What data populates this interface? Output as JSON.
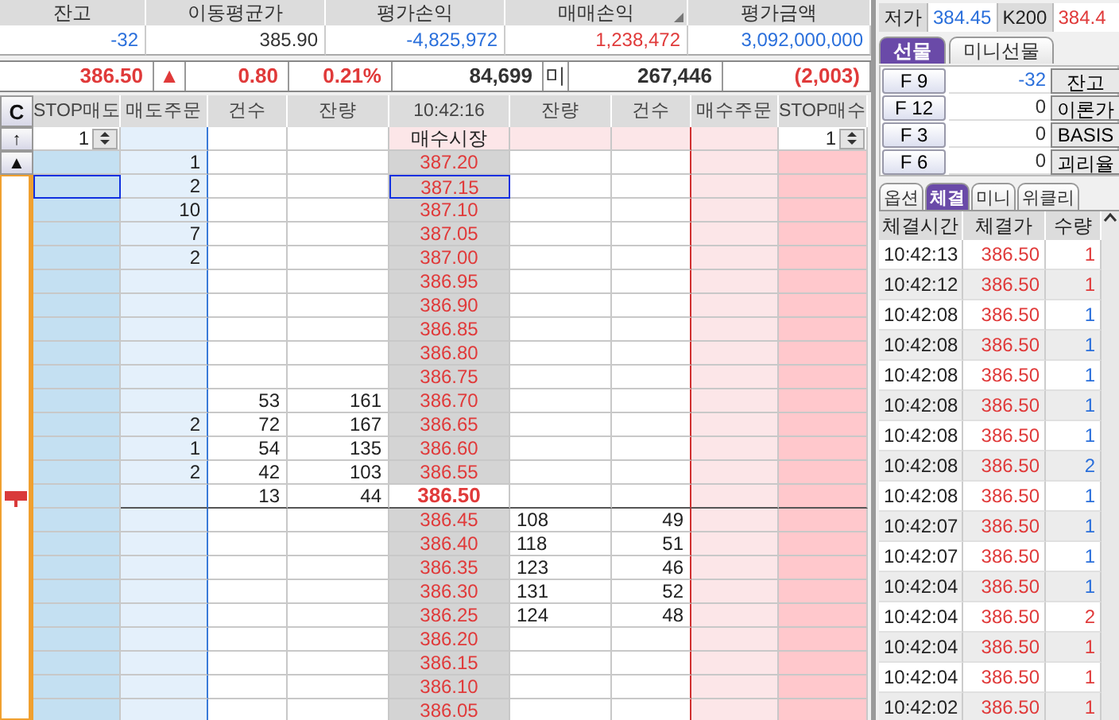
{
  "summary": {
    "columns": [
      {
        "label": "잔고",
        "value": "-32",
        "color": "#2a6fdb"
      },
      {
        "label": "이동평균가",
        "value": "385.90",
        "color": "#333333"
      },
      {
        "label": "평가손익",
        "value": "-4,825,972",
        "color": "#2a6fdb"
      },
      {
        "label": "매매손익",
        "value": "1,238,472",
        "color": "#e03a3a"
      },
      {
        "label": "평가금액",
        "value": "3,092,000,000",
        "color": "#2a6fdb"
      }
    ]
  },
  "quote_bar": [
    {
      "text": "386.50",
      "color": "#e03a3a"
    },
    {
      "text": "▲",
      "color": "#e03a3a"
    },
    {
      "text": "0.80",
      "color": "#e03a3a"
    },
    {
      "text": "0.21%",
      "color": "#e03a3a"
    },
    {
      "text": "84,699",
      "color": "#333333"
    },
    {
      "text": "미",
      "color": "#333333"
    },
    {
      "text": "267,446",
      "color": "#333333"
    },
    {
      "text": "(2,003)",
      "color": "#e03a3a"
    }
  ],
  "order_book": {
    "side_buttons": [
      "C",
      "↑",
      "▲"
    ],
    "columns": [
      "STOP매도",
      "매도주문",
      "건수",
      "잔량",
      "10:42:16",
      "잔량",
      "건수",
      "매수주문",
      "STOP매수"
    ],
    "stop_sell_qty": "1",
    "stop_buy_qty": "1",
    "market_buy_label": "매수시장",
    "rows": [
      {
        "price": "387.20",
        "sell_order": "1",
        "selected": false,
        "current": false
      },
      {
        "price": "387.15",
        "sell_order": "2",
        "selected": true,
        "current": false
      },
      {
        "price": "387.10",
        "sell_order": "10",
        "selected": false,
        "current": false
      },
      {
        "price": "387.05",
        "sell_order": "7",
        "selected": false,
        "current": false
      },
      {
        "price": "387.00",
        "sell_order": "2",
        "selected": false,
        "current": false
      },
      {
        "price": "386.95",
        "selected": false,
        "current": false
      },
      {
        "price": "386.90",
        "selected": false,
        "current": false
      },
      {
        "price": "386.85",
        "selected": false,
        "current": false
      },
      {
        "price": "386.80",
        "selected": false,
        "current": false
      },
      {
        "price": "386.75",
        "selected": false,
        "current": false
      },
      {
        "price": "386.70",
        "sell_count": "53",
        "sell_qty": "161",
        "selected": false,
        "current": false
      },
      {
        "price": "386.65",
        "sell_order": "2",
        "sell_count": "72",
        "sell_qty": "167",
        "selected": false,
        "current": false
      },
      {
        "price": "386.60",
        "sell_order": "1",
        "sell_count": "54",
        "sell_qty": "135",
        "selected": false,
        "current": false
      },
      {
        "price": "386.55",
        "sell_order": "2",
        "sell_count": "42",
        "sell_qty": "103",
        "selected": false,
        "current": false
      },
      {
        "price": "386.50",
        "sell_count": "13",
        "sell_qty": "44",
        "selected": false,
        "current": true
      },
      {
        "price": "386.45",
        "buy_qty": "108",
        "buy_count": "49",
        "selected": false,
        "current": false
      },
      {
        "price": "386.40",
        "buy_qty": "118",
        "buy_count": "51",
        "selected": false,
        "current": false
      },
      {
        "price": "386.35",
        "buy_qty": "123",
        "buy_count": "46",
        "selected": false,
        "current": false
      },
      {
        "price": "386.30",
        "buy_qty": "131",
        "buy_count": "52",
        "selected": false,
        "current": false
      },
      {
        "price": "386.25",
        "buy_qty": "124",
        "buy_count": "48",
        "selected": false,
        "current": false
      },
      {
        "price": "386.20",
        "selected": false,
        "current": false
      },
      {
        "price": "386.15",
        "selected": false,
        "current": false
      },
      {
        "price": "386.10",
        "selected": false,
        "current": false
      },
      {
        "price": "386.05",
        "selected": false,
        "current": false
      }
    ]
  },
  "side_panel": {
    "quotes": [
      {
        "label": "저가",
        "value": "384.45",
        "color": "#2a6fdb"
      },
      {
        "label": "K200",
        "value": "384.4",
        "color": "#e03a3a"
      }
    ],
    "futures_tabs": [
      {
        "label": "선물",
        "selected": true
      },
      {
        "label": "미니선물",
        "selected": false
      }
    ],
    "futures_rows": [
      {
        "code": "F 9",
        "value": "-32",
        "color": "#2a6fdb",
        "button": "잔고"
      },
      {
        "code": "F 12",
        "value": "0",
        "color": "#333333",
        "button": "이론가"
      },
      {
        "code": "F 3",
        "value": "0",
        "color": "#333333",
        "button": "BASIS"
      },
      {
        "code": "F 6",
        "value": "0",
        "color": "#333333",
        "button": "괴리율"
      }
    ],
    "trade_tabs": [
      {
        "label": "옵션",
        "selected": false
      },
      {
        "label": "체결",
        "selected": true
      },
      {
        "label": "미니",
        "selected": false
      },
      {
        "label": "위클리",
        "selected": false
      }
    ],
    "trade_columns": [
      "체결시간",
      "체결가",
      "수량"
    ],
    "trades": [
      {
        "time": "10:42:13",
        "price": "386.50",
        "qty": "1",
        "color": "#e03a3a"
      },
      {
        "time": "10:42:12",
        "price": "386.50",
        "qty": "1",
        "color": "#e03a3a"
      },
      {
        "time": "10:42:08",
        "price": "386.50",
        "qty": "1",
        "color": "#2a6fdb"
      },
      {
        "time": "10:42:08",
        "price": "386.50",
        "qty": "1",
        "color": "#2a6fdb"
      },
      {
        "time": "10:42:08",
        "price": "386.50",
        "qty": "1",
        "color": "#2a6fdb"
      },
      {
        "time": "10:42:08",
        "price": "386.50",
        "qty": "1",
        "color": "#2a6fdb"
      },
      {
        "time": "10:42:08",
        "price": "386.50",
        "qty": "1",
        "color": "#2a6fdb"
      },
      {
        "time": "10:42:08",
        "price": "386.50",
        "qty": "2",
        "color": "#2a6fdb"
      },
      {
        "time": "10:42:08",
        "price": "386.50",
        "qty": "1",
        "color": "#2a6fdb"
      },
      {
        "time": "10:42:07",
        "price": "386.50",
        "qty": "1",
        "color": "#2a6fdb"
      },
      {
        "time": "10:42:07",
        "price": "386.50",
        "qty": "1",
        "color": "#2a6fdb"
      },
      {
        "time": "10:42:04",
        "price": "386.50",
        "qty": "1",
        "color": "#2a6fdb"
      },
      {
        "time": "10:42:04",
        "price": "386.50",
        "qty": "2",
        "color": "#e03a3a"
      },
      {
        "time": "10:42:04",
        "price": "386.50",
        "qty": "1",
        "color": "#e03a3a"
      },
      {
        "time": "10:42:04",
        "price": "386.50",
        "qty": "1",
        "color": "#e03a3a"
      },
      {
        "time": "10:42:02",
        "price": "386.50",
        "qty": "1",
        "color": "#e03a3a"
      }
    ]
  }
}
